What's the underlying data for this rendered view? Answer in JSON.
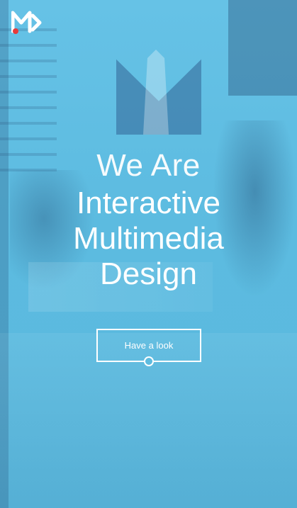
{
  "hero": {
    "headline_thin": "We Are",
    "headline_lines": [
      "Interactive",
      "Multimedia",
      "Design"
    ]
  },
  "cta": {
    "label": "Have a look"
  },
  "colors": {
    "accent": "#5dbbdf",
    "logo_dot": "#e63b3b",
    "text": "#ffffff"
  },
  "icons": {
    "logo": "md-logo-icon",
    "scroll_knob": "circle-knob-icon"
  }
}
